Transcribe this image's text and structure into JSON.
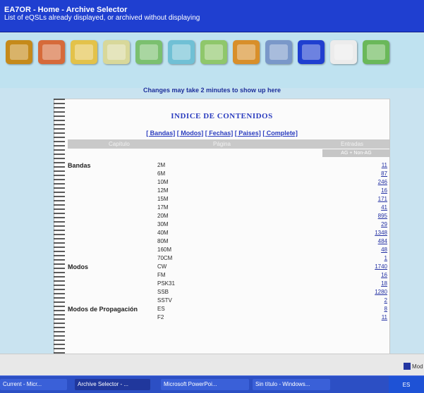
{
  "window": {
    "title": "EA7OR - Home - Archive Selector",
    "subtitle": "List of eQSLs already displayed, or archived without displaying"
  },
  "toolbar": {
    "icons": [
      {
        "name": "key-icon",
        "color": "#c58a1a"
      },
      {
        "name": "delete-folder-icon",
        "color": "#d66a3a"
      },
      {
        "name": "folder-icon",
        "color": "#e3c24a"
      },
      {
        "name": "edit-document-icon",
        "color": "#d8d89a"
      },
      {
        "name": "green-document-icon",
        "color": "#7bc06f"
      },
      {
        "name": "pencil-icon",
        "color": "#70c0d5"
      },
      {
        "name": "image-icon",
        "color": "#8fc76b"
      },
      {
        "name": "bookmark-icon",
        "color": "#d88f2a"
      },
      {
        "name": "cd-icon",
        "color": "#7a98c9"
      },
      {
        "name": "s-button-icon",
        "color": "#1f3fd0"
      },
      {
        "name": "question-icon",
        "color": "#ececec"
      },
      {
        "name": "logout-icon",
        "color": "#6ab85a"
      }
    ]
  },
  "notice": "Changes may take 2 minutes to show up here",
  "index": {
    "title": "INDICE DE CONTENIDOS",
    "links": [
      "[ Bandas]",
      "[ Modos]",
      "[ Fechas]",
      "[ Paises]",
      "[ Complete]"
    ],
    "columns": [
      "Capítulo",
      "Página",
      "Entradas"
    ],
    "subheader": "AG + Non-AG",
    "rows": [
      {
        "category": "Bandas",
        "page": "2M",
        "entries": "11"
      },
      {
        "category": "",
        "page": "6M",
        "entries": "87"
      },
      {
        "category": "",
        "page": "10M",
        "entries": "246"
      },
      {
        "category": "",
        "page": "12M",
        "entries": "16"
      },
      {
        "category": "",
        "page": "15M",
        "entries": "171"
      },
      {
        "category": "",
        "page": "17M",
        "entries": "41"
      },
      {
        "category": "",
        "page": "20M",
        "entries": "895"
      },
      {
        "category": "",
        "page": "30M",
        "entries": "29"
      },
      {
        "category": "",
        "page": "40M",
        "entries": "1348"
      },
      {
        "category": "",
        "page": "80M",
        "entries": "484"
      },
      {
        "category": "",
        "page": "160M",
        "entries": "48"
      },
      {
        "category": "",
        "page": "70CM",
        "entries": "1"
      },
      {
        "category": "Modos",
        "page": "CW",
        "entries": "1740"
      },
      {
        "category": "",
        "page": "FM",
        "entries": "16"
      },
      {
        "category": "",
        "page": "PSK31",
        "entries": "18"
      },
      {
        "category": "",
        "page": "SSB",
        "entries": "1280"
      },
      {
        "category": "",
        "page": "SSTV",
        "entries": "2"
      },
      {
        "category": "Modos de Propagación",
        "page": "ES",
        "entries": "8"
      },
      {
        "category": "",
        "page": "F2",
        "entries": "11"
      }
    ]
  },
  "bottom_button": "Mod",
  "taskbar": {
    "items": [
      "Current - Micr...",
      "Archive Selector - ...",
      "Microsoft PowerPoi...",
      "Sin título - Windows..."
    ],
    "tray": "ES"
  }
}
